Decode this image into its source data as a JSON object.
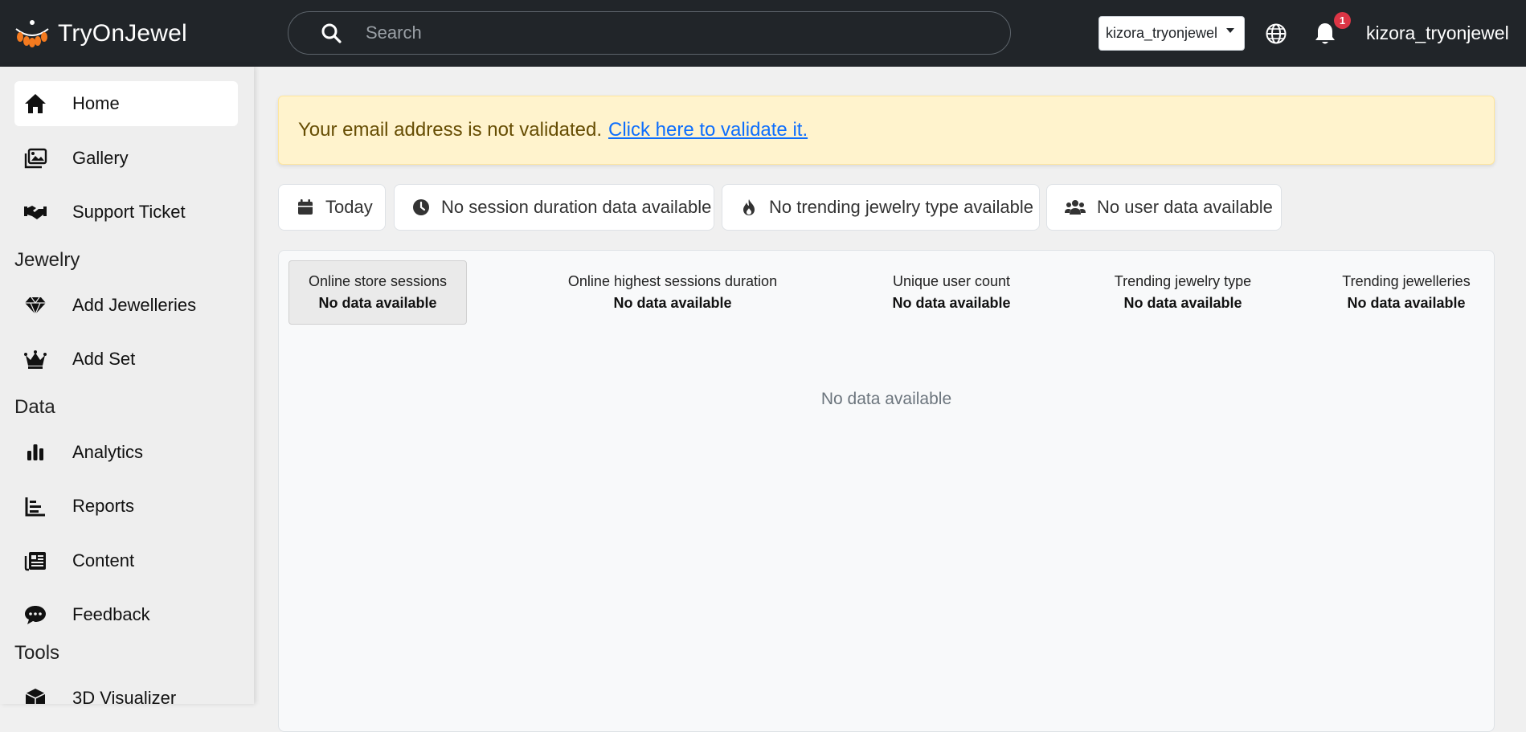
{
  "app": {
    "brand_name": "TryOnJewel",
    "logo_icon": "jewel-logo-icon"
  },
  "header": {
    "search_placeholder": "Search",
    "store_selected": "kizora_tryonjewel",
    "notification_count": "1",
    "username": "kizora_tryonjewel"
  },
  "sidebar": {
    "items_top": [
      {
        "label": "Home",
        "icon": "home-icon",
        "active": true
      },
      {
        "label": "Gallery",
        "icon": "gallery-icon"
      },
      {
        "label": "Support Ticket",
        "icon": "handshake-icon"
      }
    ],
    "section_jewelry": "Jewelry",
    "items_jewelry": [
      {
        "label": "Add Jewelleries",
        "icon": "gem-icon"
      },
      {
        "label": "Add Set",
        "icon": "crown-icon"
      }
    ],
    "section_data": "Data",
    "items_data": [
      {
        "label": "Analytics",
        "icon": "bar-chart-icon"
      },
      {
        "label": "Reports",
        "icon": "reports-icon"
      },
      {
        "label": "Content",
        "icon": "newspaper-icon"
      },
      {
        "label": "Feedback",
        "icon": "comment-icon"
      }
    ],
    "section_tools": "Tools",
    "items_tools": [
      {
        "label": "3D Visualizer",
        "icon": "cube-icon"
      }
    ]
  },
  "alert": {
    "message": "Your email address is not validated.",
    "link_text": "Click here to validate it."
  },
  "filters": [
    {
      "label": "Today",
      "icon": "calendar-icon"
    },
    {
      "label": "No session duration data available",
      "icon": "clock-icon"
    },
    {
      "label": "No trending jewelry type available",
      "icon": "fire-icon"
    },
    {
      "label": "No user data available",
      "icon": "users-icon"
    }
  ],
  "stats": [
    {
      "label": "Online store sessions",
      "value": "No data available",
      "active": true
    },
    {
      "label": "Online highest sessions duration",
      "value": "No data available"
    },
    {
      "label": "Unique user count",
      "value": "No data available"
    },
    {
      "label": "Trending jewelry type",
      "value": "No data available"
    },
    {
      "label": "Trending jewelleries",
      "value": "No data available"
    }
  ],
  "empty_message": "No data available",
  "colors": {
    "topbar": "#212529",
    "alert_bg": "#fff3cd",
    "alert_text": "#664d03",
    "link": "#0d6efd",
    "badge": "#dc3545"
  }
}
